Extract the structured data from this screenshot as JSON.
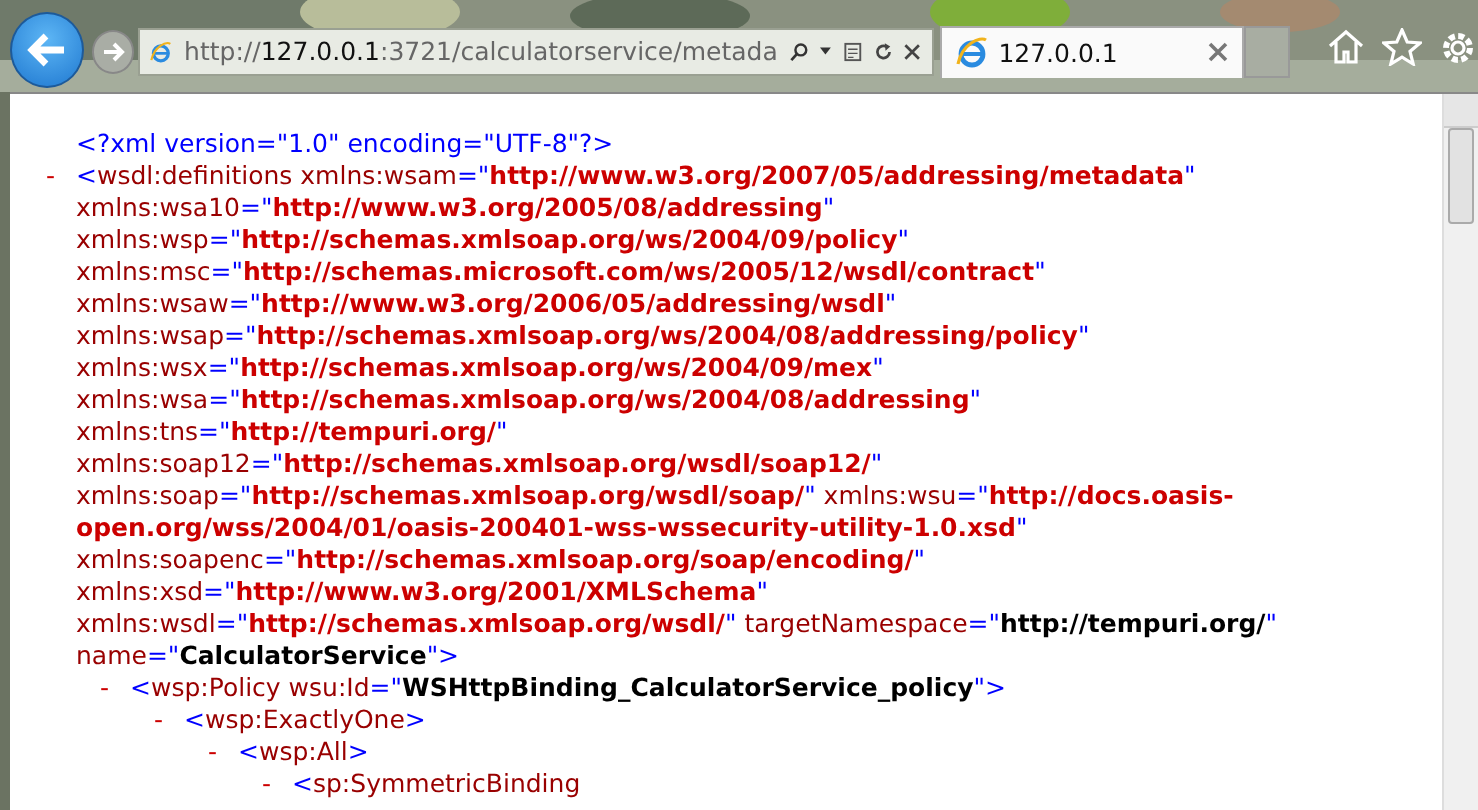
{
  "browser": {
    "url_scheme": "http://",
    "url_host": "127.0.0.1",
    "url_path": ":3721/calculatorservice/metada",
    "tabs": [
      {
        "title": "127.0.0.1",
        "selected": true
      }
    ]
  },
  "document": {
    "tree": [
      {
        "lines": [
          [
            {
              "kind": "markup",
              "text": "<?xml version=\"1.0\" encoding=\"UTF-8\"?>"
            }
          ]
        ]
      },
      {
        "toggle": "-",
        "lines": [
          [
            {
              "kind": "markup",
              "text": "<"
            },
            {
              "kind": "name",
              "text": "wsdl:definitions xmlns:wsam"
            },
            {
              "kind": "markup",
              "text": "=\""
            },
            {
              "kind": "value",
              "text": "http://www.w3.org/2007/05/addressing/metadata"
            },
            {
              "kind": "markup",
              "text": "\""
            }
          ],
          [
            {
              "kind": "name",
              "text": "xmlns:wsa10"
            },
            {
              "kind": "markup",
              "text": "=\""
            },
            {
              "kind": "value",
              "text": "http://www.w3.org/2005/08/addressing"
            },
            {
              "kind": "markup",
              "text": "\""
            }
          ],
          [
            {
              "kind": "name",
              "text": "xmlns:wsp"
            },
            {
              "kind": "markup",
              "text": "=\""
            },
            {
              "kind": "value",
              "text": "http://schemas.xmlsoap.org/ws/2004/09/policy"
            },
            {
              "kind": "markup",
              "text": "\""
            }
          ],
          [
            {
              "kind": "name",
              "text": "xmlns:msc"
            },
            {
              "kind": "markup",
              "text": "=\""
            },
            {
              "kind": "value",
              "text": "http://schemas.microsoft.com/ws/2005/12/wsdl/contract"
            },
            {
              "kind": "markup",
              "text": "\""
            }
          ],
          [
            {
              "kind": "name",
              "text": "xmlns:wsaw"
            },
            {
              "kind": "markup",
              "text": "=\""
            },
            {
              "kind": "value",
              "text": "http://www.w3.org/2006/05/addressing/wsdl"
            },
            {
              "kind": "markup",
              "text": "\""
            }
          ],
          [
            {
              "kind": "name",
              "text": "xmlns:wsap"
            },
            {
              "kind": "markup",
              "text": "=\""
            },
            {
              "kind": "value",
              "text": "http://schemas.xmlsoap.org/ws/2004/08/addressing/policy"
            },
            {
              "kind": "markup",
              "text": "\""
            }
          ],
          [
            {
              "kind": "name",
              "text": "xmlns:wsx"
            },
            {
              "kind": "markup",
              "text": "=\""
            },
            {
              "kind": "value",
              "text": "http://schemas.xmlsoap.org/ws/2004/09/mex"
            },
            {
              "kind": "markup",
              "text": "\""
            }
          ],
          [
            {
              "kind": "name",
              "text": "xmlns:wsa"
            },
            {
              "kind": "markup",
              "text": "=\""
            },
            {
              "kind": "value",
              "text": "http://schemas.xmlsoap.org/ws/2004/08/addressing"
            },
            {
              "kind": "markup",
              "text": "\""
            }
          ],
          [
            {
              "kind": "name",
              "text": "xmlns:tns"
            },
            {
              "kind": "markup",
              "text": "=\""
            },
            {
              "kind": "value",
              "text": "http://tempuri.org/"
            },
            {
              "kind": "markup",
              "text": "\""
            }
          ],
          [
            {
              "kind": "name",
              "text": "xmlns:soap12"
            },
            {
              "kind": "markup",
              "text": "=\""
            },
            {
              "kind": "value",
              "text": "http://schemas.xmlsoap.org/wsdl/soap12/"
            },
            {
              "kind": "markup",
              "text": "\""
            }
          ],
          [
            {
              "kind": "name",
              "text": "xmlns:soap"
            },
            {
              "kind": "markup",
              "text": "=\""
            },
            {
              "kind": "value",
              "text": "http://schemas.xmlsoap.org/wsdl/soap/"
            },
            {
              "kind": "markup",
              "text": "\" "
            },
            {
              "kind": "name",
              "text": "xmlns:wsu"
            },
            {
              "kind": "markup",
              "text": "=\""
            },
            {
              "kind": "value",
              "text": "http://docs.oasis-"
            }
          ],
          [
            {
              "kind": "value",
              "text": "open.org/wss/2004/01/oasis-200401-wss-wssecurity-utility-1.0.xsd"
            },
            {
              "kind": "markup",
              "text": "\""
            }
          ],
          [
            {
              "kind": "name",
              "text": "xmlns:soapenc"
            },
            {
              "kind": "markup",
              "text": "=\""
            },
            {
              "kind": "value",
              "text": "http://schemas.xmlsoap.org/soap/encoding/"
            },
            {
              "kind": "markup",
              "text": "\""
            }
          ],
          [
            {
              "kind": "name",
              "text": "xmlns:xsd"
            },
            {
              "kind": "markup",
              "text": "=\""
            },
            {
              "kind": "value",
              "text": "http://www.w3.org/2001/XMLSchema"
            },
            {
              "kind": "markup",
              "text": "\""
            }
          ],
          [
            {
              "kind": "name",
              "text": "xmlns:wsdl"
            },
            {
              "kind": "markup",
              "text": "=\""
            },
            {
              "kind": "value",
              "text": "http://schemas.xmlsoap.org/wsdl/"
            },
            {
              "kind": "markup",
              "text": "\" "
            },
            {
              "kind": "name",
              "text": "targetNamespace"
            },
            {
              "kind": "markup",
              "text": "=\""
            },
            {
              "kind": "strong",
              "text": "http://tempuri.org/"
            },
            {
              "kind": "markup",
              "text": "\""
            }
          ],
          [
            {
              "kind": "name",
              "text": "name"
            },
            {
              "kind": "markup",
              "text": "=\""
            },
            {
              "kind": "strong",
              "text": "CalculatorService"
            },
            {
              "kind": "markup",
              "text": "\">"
            }
          ]
        ],
        "children": [
          {
            "toggle": "-",
            "lines": [
              [
                {
                  "kind": "markup",
                  "text": "<"
                },
                {
                  "kind": "name",
                  "text": "wsp:Policy wsu:Id"
                },
                {
                  "kind": "markup",
                  "text": "=\""
                },
                {
                  "kind": "strong",
                  "text": "WSHttpBinding_CalculatorService_policy"
                },
                {
                  "kind": "markup",
                  "text": "\">"
                }
              ]
            ],
            "children": [
              {
                "toggle": "-",
                "lines": [
                  [
                    {
                      "kind": "markup",
                      "text": "<"
                    },
                    {
                      "kind": "name",
                      "text": "wsp:ExactlyOne"
                    },
                    {
                      "kind": "markup",
                      "text": ">"
                    }
                  ]
                ],
                "children": [
                  {
                    "toggle": "-",
                    "lines": [
                      [
                        {
                          "kind": "markup",
                          "text": "<"
                        },
                        {
                          "kind": "name",
                          "text": "wsp:All"
                        },
                        {
                          "kind": "markup",
                          "text": ">"
                        }
                      ]
                    ],
                    "children": [
                      {
                        "toggle": "-",
                        "lines": [
                          [
                            {
                              "kind": "markup",
                              "text": "<"
                            },
                            {
                              "kind": "name",
                              "text": "sp:SymmetricBinding"
                            }
                          ]
                        ]
                      }
                    ]
                  }
                ]
              }
            ]
          }
        ]
      }
    ]
  }
}
